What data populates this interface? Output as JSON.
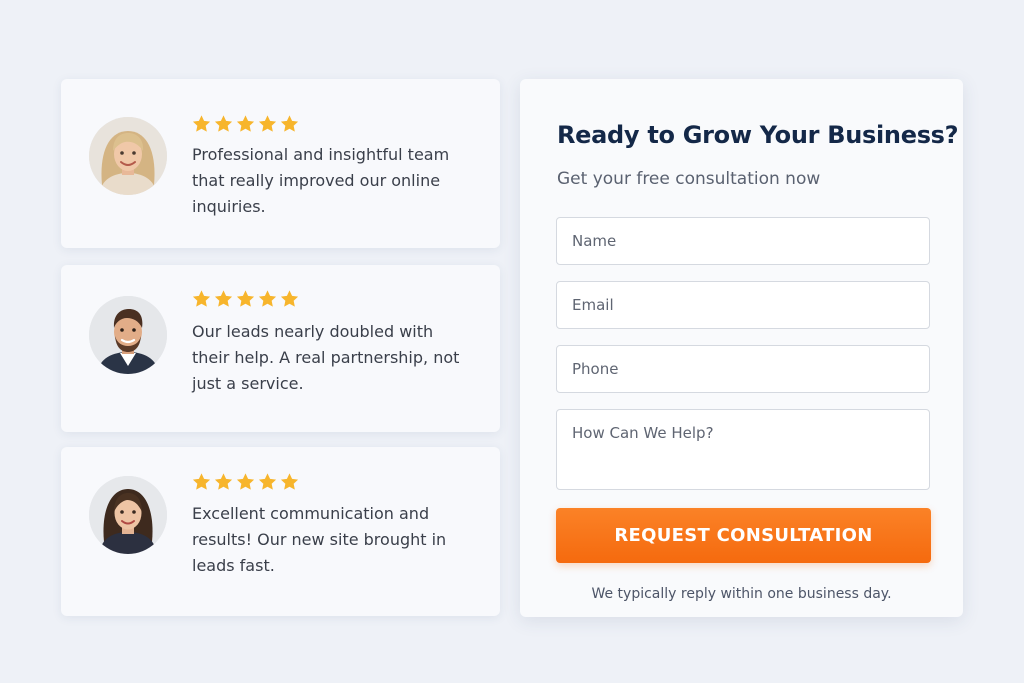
{
  "colors": {
    "background": "#eef1f7",
    "star": "#f7b52c",
    "title": "#142848",
    "button": "#f56a0e"
  },
  "testimonials": [
    {
      "rating": 5,
      "avatar_icon": "person-avatar-woman-blonde",
      "quote": "Professional and insightful team that really improved our online inquiries."
    },
    {
      "rating": 5,
      "avatar_icon": "person-avatar-man-beard",
      "quote": "Our leads nearly doubled with their help. A real partnership, not just a service."
    },
    {
      "rating": 5,
      "avatar_icon": "person-avatar-woman-brunette",
      "quote": "Excellent communication and results! Our new site brought in leads fast."
    }
  ],
  "form": {
    "title": "Ready to Grow Your Business?",
    "subtitle": "Get your free consultation now",
    "name_placeholder": "Name",
    "email_placeholder": "Email",
    "phone_placeholder": "Phone",
    "message_placeholder": "How Can We Help?",
    "submit_label": "REQUEST CONSULTATION",
    "reply_note": "We typically reply within one business day."
  }
}
